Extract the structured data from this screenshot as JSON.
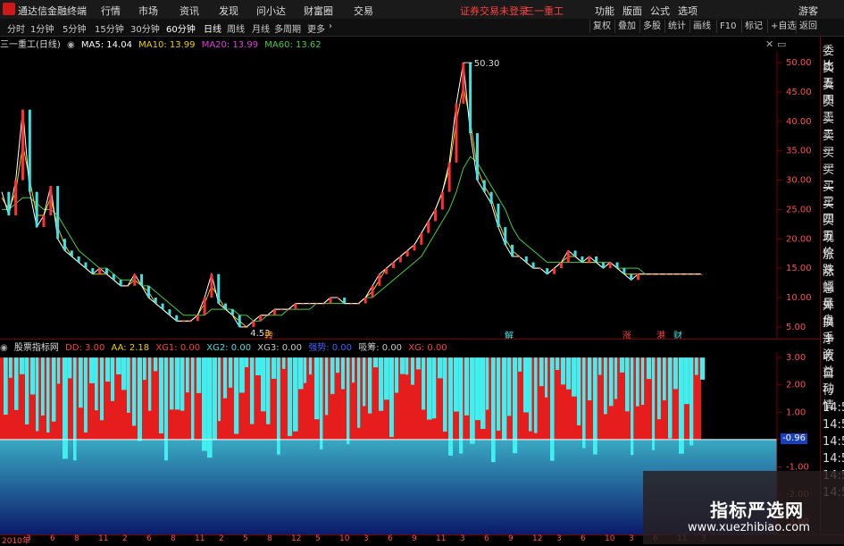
{
  "menubar": {
    "app_title": "通达信金融终端",
    "menus": [
      "行情",
      "市场",
      "资讯",
      "发现",
      "问小达",
      "财富圈",
      "交易"
    ],
    "notice": "证券交易未登录",
    "stock": "三一重工",
    "right_menus": [
      "功能",
      "版面",
      "公式",
      "选项"
    ],
    "guest": "游客"
  },
  "toolbar": {
    "periods": [
      "分时",
      "1分钟",
      "5分钟",
      "15分钟",
      "30分钟",
      "60分钟",
      "日线",
      "周线",
      "月线",
      "多周期",
      "更多"
    ],
    "active_period": "日线",
    "right_items": [
      "复权",
      "叠加",
      "多股",
      "统计",
      "画线",
      "F10",
      "标记",
      "+自选",
      "返回"
    ]
  },
  "main_chart": {
    "title": "三一重工(日线)",
    "ma": [
      {
        "label": "MA5: 14.04",
        "color": "#ffffff"
      },
      {
        "label": "MA10: 13.99",
        "color": "#f0d000"
      },
      {
        "label": "MA20: 13.99",
        "color": "#e040e0"
      },
      {
        "label": "MA60: 13.62",
        "color": "#40d040"
      }
    ],
    "max_label": "50.30",
    "min_label": "4.53",
    "markers": [
      "转",
      "解",
      "涨",
      "港",
      "财"
    ]
  },
  "indicator": {
    "name": "股票指标网",
    "items": [
      {
        "label": "DD: 3.00",
        "color": "#ff4040"
      },
      {
        "label": "AA: 2.18",
        "color": "#f0d000"
      },
      {
        "label": "XG1: 0.00",
        "color": "#ff4040"
      },
      {
        "label": "XG2: 0.00",
        "color": "#40e0e0"
      },
      {
        "label": "XG3: 0.00",
        "color": "#c8c8c8"
      },
      {
        "label": "强势: 0.00",
        "color": "#4060ff"
      },
      {
        "label": "吸筹: 0.00",
        "color": "#c8c8c8"
      },
      {
        "label": "XG: 0.00",
        "color": "#ff4040"
      }
    ],
    "current_label": "-0.96"
  },
  "right_panel": {
    "items": [
      "委比",
      "卖五",
      "卖四",
      "卖三",
      "卖二",
      "卖一",
      "买一",
      "买二",
      "买三",
      "买四",
      "买五",
      "现价",
      "涨跌",
      "涨幅",
      "总量",
      "外盘",
      "换手",
      "净资",
      "收益",
      "自动",
      "行情",
      "14:5",
      "14:5",
      "14:5",
      "14:5",
      "14:5",
      "14:5"
    ]
  },
  "time_axis": {
    "labels": [
      "2010年",
      "3",
      "6",
      "8",
      "11",
      "2",
      "6",
      "8",
      "11",
      "2",
      "5",
      "8",
      "12",
      "5",
      "10",
      "3",
      "6",
      "9",
      "11",
      "3",
      "6",
      "9",
      "12",
      "3",
      "6",
      "10",
      "3",
      "6",
      "11",
      "3"
    ]
  },
  "watermark": {
    "title": "指标严选网",
    "url": "www.xuezhibiao.com"
  },
  "chart_data": [
    {
      "type": "line",
      "title": "三一重工(日线)",
      "ylabel": "",
      "ylim": [
        3,
        52
      ],
      "yticks": [
        5.0,
        10.0,
        15.0,
        20.0,
        25.0,
        30.0,
        35.0,
        40.0,
        45.0,
        50.0
      ],
      "x": [
        0,
        2,
        4,
        6,
        8,
        10,
        12,
        14,
        16,
        18,
        20,
        22,
        24,
        26,
        28,
        30,
        32,
        34,
        36,
        38,
        40,
        42,
        44,
        46,
        48,
        50,
        52,
        54,
        56,
        58,
        60,
        62,
        64,
        66,
        68,
        70,
        72,
        74,
        76,
        78,
        80,
        82,
        84,
        86,
        88,
        90,
        92,
        94,
        96,
        98,
        100,
        102,
        104,
        106,
        108,
        110,
        112,
        114,
        116,
        118,
        120,
        122,
        124,
        126,
        128,
        130,
        132,
        134,
        136,
        138,
        140,
        142,
        144,
        146,
        148,
        150,
        152,
        154,
        156,
        158,
        160,
        162,
        164,
        166,
        168,
        170,
        172,
        174,
        176,
        178,
        180,
        182,
        184,
        186,
        188,
        190,
        192,
        194,
        196,
        198,
        200
      ],
      "series": [
        {
          "name": "price",
          "values": [
            28,
            24,
            30,
            42,
            28,
            22,
            24,
            29,
            20,
            18,
            17,
            16,
            15,
            14,
            15,
            14,
            13,
            12,
            12,
            14,
            12,
            10,
            9,
            8,
            7,
            6,
            6,
            6,
            7,
            10,
            14,
            9,
            8,
            7,
            5,
            5,
            6,
            7,
            7,
            8,
            8,
            8,
            9,
            9,
            9,
            9,
            9,
            10,
            10,
            9,
            9,
            9,
            10,
            12,
            14,
            15,
            16,
            17,
            18,
            19,
            21,
            23,
            25,
            28,
            33,
            43,
            50,
            38,
            30,
            28,
            26,
            22,
            19,
            17,
            17,
            16,
            15,
            15,
            14,
            15,
            16,
            18,
            17,
            16,
            17,
            16,
            15,
            16,
            15,
            14,
            13,
            14,
            14,
            14,
            14,
            14,
            14,
            14,
            14,
            14,
            14
          ]
        },
        {
          "name": "MA5",
          "values": [
            27,
            25,
            28,
            36,
            30,
            24,
            24,
            27,
            22,
            19,
            17,
            16,
            15,
            14,
            14,
            14,
            13,
            12,
            12,
            13,
            12,
            11,
            9,
            8,
            7,
            6,
            6,
            6,
            7,
            9,
            12,
            10,
            8,
            7,
            6,
            5,
            6,
            7,
            7,
            8,
            8,
            8,
            9,
            9,
            9,
            9,
            9,
            10,
            10,
            9,
            9,
            9,
            10,
            11,
            13,
            15,
            16,
            17,
            18,
            19,
            21,
            23,
            25,
            28,
            32,
            40,
            46,
            40,
            32,
            29,
            27,
            23,
            20,
            18,
            17,
            16,
            15,
            15,
            14,
            15,
            16,
            17,
            17,
            16,
            16,
            16,
            15,
            16,
            15,
            14,
            14,
            14,
            14,
            14,
            14,
            14,
            14,
            14,
            14,
            14,
            14
          ]
        },
        {
          "name": "MA60",
          "values": [
            25,
            25,
            26,
            27,
            27,
            26,
            25,
            25,
            24,
            22,
            20,
            18,
            17,
            16,
            15,
            15,
            14,
            13,
            13,
            13,
            12,
            12,
            11,
            10,
            9,
            8,
            7,
            7,
            7,
            7,
            8,
            8,
            8,
            8,
            7,
            7,
            6,
            6,
            7,
            7,
            7,
            8,
            8,
            8,
            8,
            9,
            9,
            9,
            9,
            9,
            9,
            9,
            10,
            10,
            11,
            12,
            13,
            14,
            15,
            16,
            17,
            19,
            21,
            23,
            25,
            28,
            32,
            34,
            33,
            31,
            29,
            27,
            25,
            22,
            20,
            19,
            18,
            17,
            16,
            16,
            16,
            16,
            16,
            16,
            16,
            16,
            16,
            16,
            15,
            15,
            15,
            15,
            14,
            14,
            14,
            14,
            14,
            14,
            14,
            14,
            14
          ]
        }
      ]
    },
    {
      "type": "bar",
      "title": "股票指标网",
      "ylim": [
        -3.5,
        3.2
      ],
      "yticks": [
        3.0,
        2.0,
        1.0,
        0.0,
        -1.0,
        -2.0,
        -3.0
      ],
      "series": [
        {
          "name": "DD",
          "values": [
            3.0
          ]
        }
      ]
    }
  ]
}
